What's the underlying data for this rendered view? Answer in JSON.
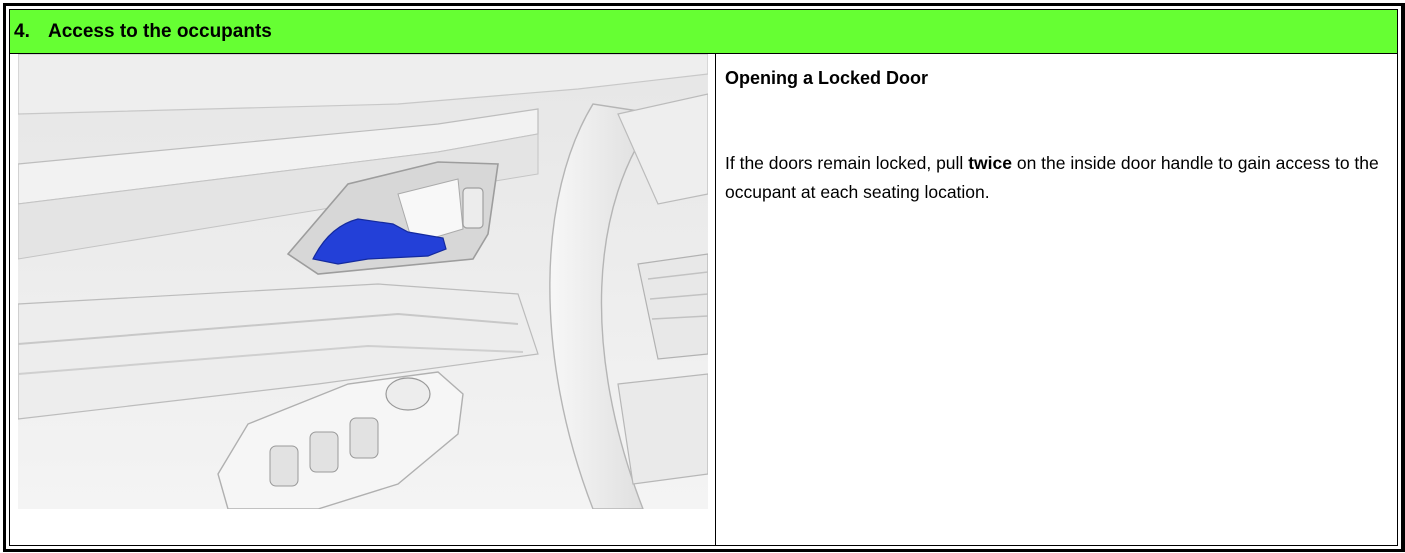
{
  "section": {
    "number": "4.",
    "title": "Access to the occupants"
  },
  "figure": {
    "highlight_color": "#2340d8"
  },
  "content": {
    "heading": "Opening a Locked Door",
    "paragraph_before": "If the doors remain locked, pull ",
    "paragraph_bold": "twice",
    "paragraph_after": " on the inside door handle to gain access to the occupant at each seating location."
  },
  "colors": {
    "header_bg": "#66ff33",
    "border": "#000000"
  }
}
